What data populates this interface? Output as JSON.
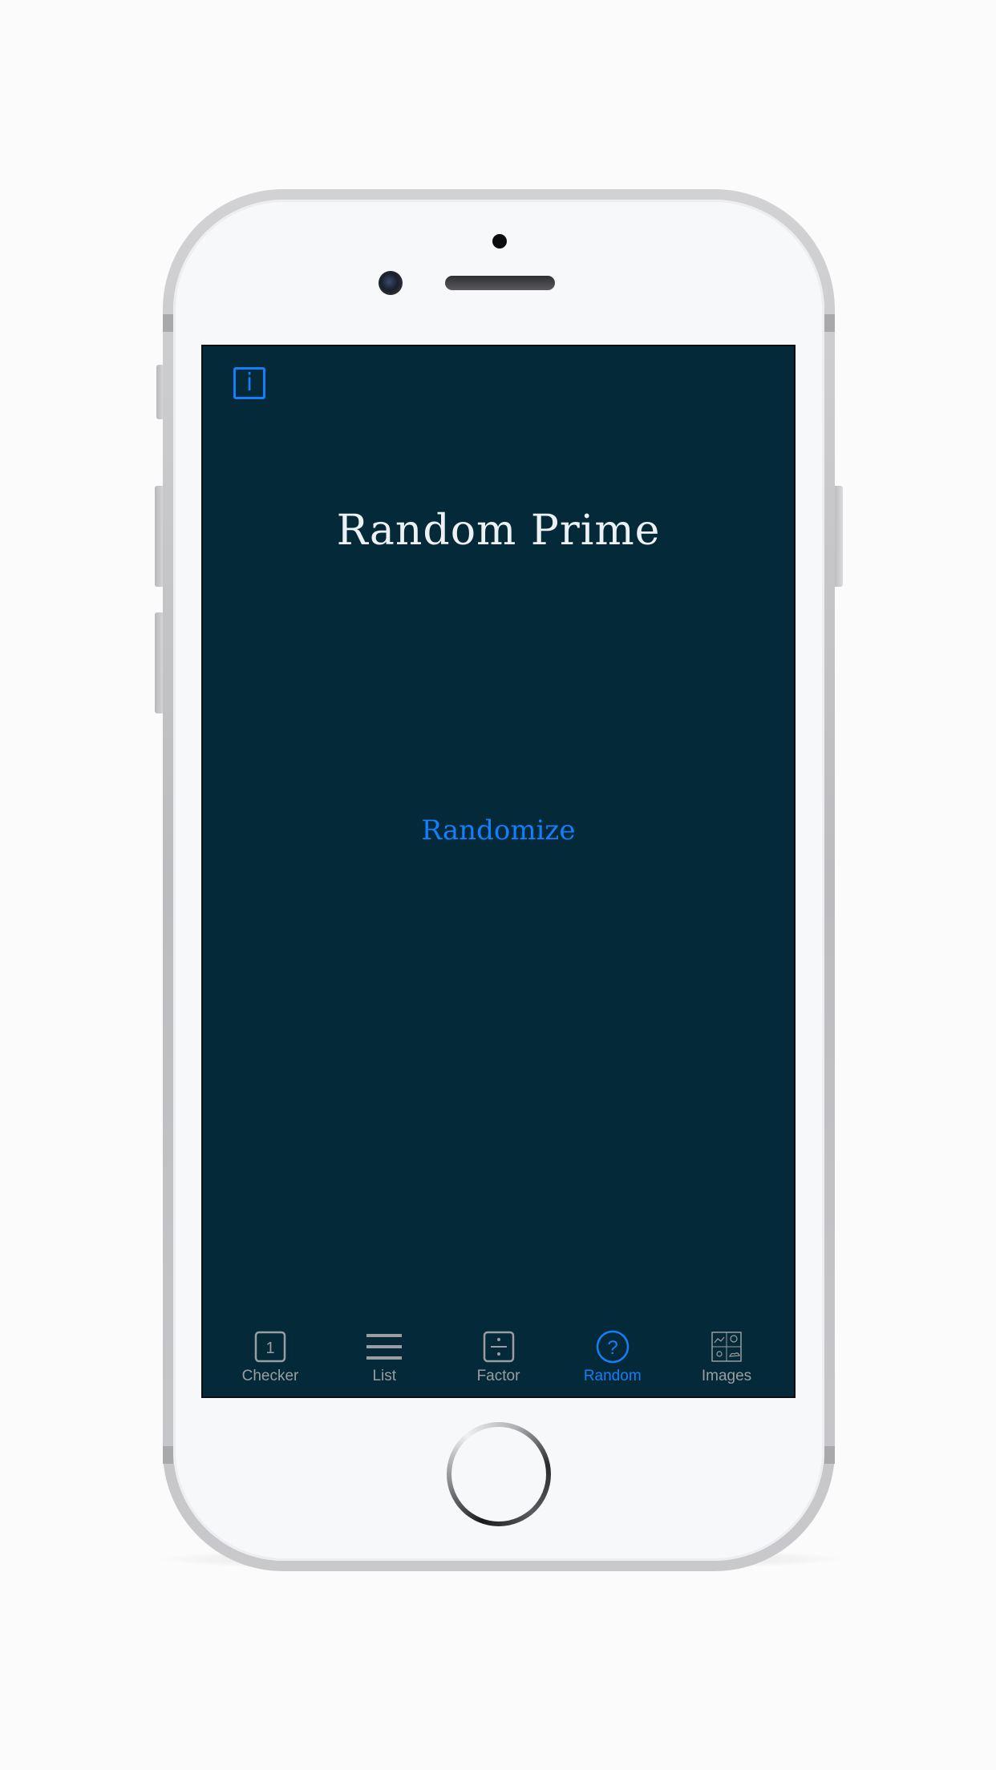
{
  "screen": {
    "info_glyph": "i",
    "title": "Random Prime",
    "action_label": "Randomize"
  },
  "tabs": [
    {
      "label": "Checker",
      "icon": "number-one-box-icon",
      "active": false
    },
    {
      "label": "List",
      "icon": "list-lines-icon",
      "active": false
    },
    {
      "label": "Factor",
      "icon": "division-box-icon",
      "active": false
    },
    {
      "label": "Random",
      "icon": "question-circle-icon",
      "active": true
    },
    {
      "label": "Images",
      "icon": "image-gallery-icon",
      "active": false
    }
  ],
  "checker_icon_glyph": "1",
  "random_icon_glyph": "?",
  "colors": {
    "background": "#042938",
    "accent": "#147efb",
    "title_text": "#eef1f3",
    "inactive_tab": "#9a9ea2"
  }
}
